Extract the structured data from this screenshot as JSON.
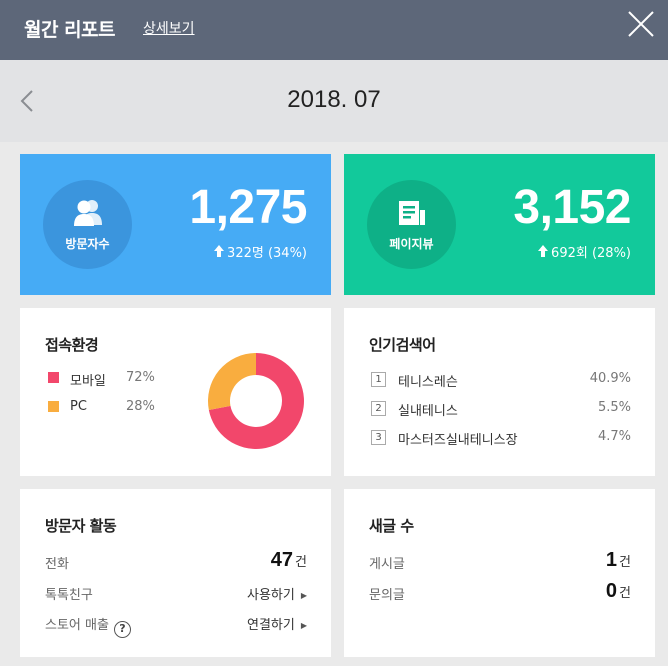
{
  "header": {
    "title": "월간 리포트",
    "detail_link": "상세보기"
  },
  "datebar": {
    "date": "2018. 07"
  },
  "stats": {
    "visitors": {
      "label": "방문자수",
      "value": "1,275",
      "delta": "322명 (34%)"
    },
    "pageviews": {
      "label": "페이지뷰",
      "value": "3,152",
      "delta": "692회 (28%)"
    }
  },
  "environment": {
    "title": "접속환경",
    "items": [
      {
        "name": "모바일",
        "percent": "72%",
        "color": "#f2476b"
      },
      {
        "name": "PC",
        "percent": "28%",
        "color": "#f9ad3f"
      }
    ]
  },
  "chart_data": {
    "type": "pie",
    "categories": [
      "모바일",
      "PC"
    ],
    "values": [
      72,
      28
    ],
    "colors": [
      "#f2476b",
      "#f9ad3f"
    ]
  },
  "popular_search": {
    "title": "인기검색어",
    "items": [
      {
        "rank": "1",
        "keyword": "테니스레슨",
        "percent": "40.9%"
      },
      {
        "rank": "2",
        "keyword": "실내테니스",
        "percent": "5.5%"
      },
      {
        "rank": "3",
        "keyword": "마스터즈실내테니스장",
        "percent": "4.7%"
      }
    ]
  },
  "activity": {
    "title": "방문자 활동",
    "call_label": "전화",
    "call_value": "47",
    "call_unit": "건",
    "talk_label": "톡톡친구",
    "talk_action": "사용하기",
    "store_label": "스토어 매출",
    "store_help": "?",
    "store_action": "연결하기"
  },
  "posts": {
    "title": "새글 수",
    "post_label": "게시글",
    "post_value": "1",
    "post_unit": "건",
    "inquiry_label": "문의글",
    "inquiry_value": "0",
    "inquiry_unit": "건"
  }
}
